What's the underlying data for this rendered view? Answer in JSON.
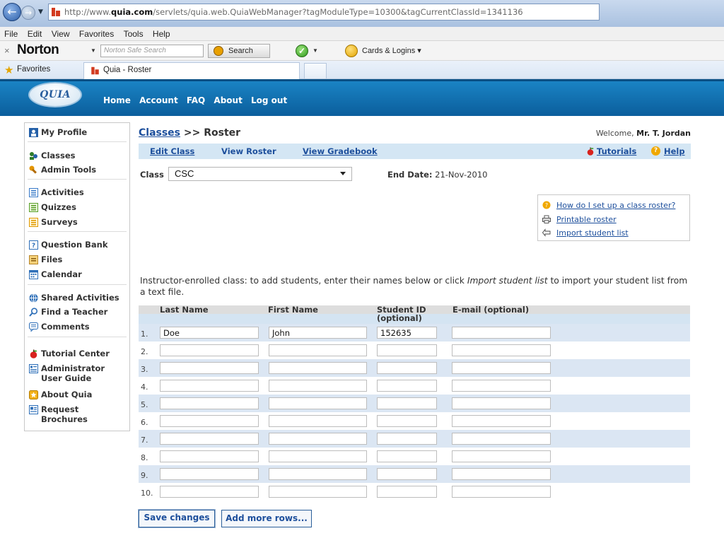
{
  "browser": {
    "url_prefix": "http://www.",
    "url_domain": "quia.com",
    "url_rest": "/servlets/quia.web.QuiaWebManager?tagModuleType=10300&tagCurrentClassId=1341136",
    "menu": [
      "File",
      "Edit",
      "View",
      "Favorites",
      "Tools",
      "Help"
    ],
    "norton_logo": "Norton",
    "norton_search_placeholder": "Norton Safe Search",
    "norton_search_button": "Search",
    "cards_logins": "Cards & Logins",
    "favorites_label": "Favorites",
    "tab_title": "Quia - Roster"
  },
  "header": {
    "logo_text": "QUIA",
    "nav": [
      "Home",
      "Account",
      "FAQ",
      "About",
      "Log out"
    ]
  },
  "sidebar": {
    "items": [
      {
        "label": "My Profile",
        "icon": "profile-icon"
      },
      {
        "label": "Classes",
        "icon": "classes-icon"
      },
      {
        "label": "Admin Tools",
        "icon": "admin-tools-icon"
      },
      {
        "label": "Activities",
        "icon": "activities-icon"
      },
      {
        "label": "Quizzes",
        "icon": "quizzes-icon"
      },
      {
        "label": "Surveys",
        "icon": "surveys-icon"
      },
      {
        "label": "Question Bank",
        "icon": "question-bank-icon"
      },
      {
        "label": "Files",
        "icon": "files-icon"
      },
      {
        "label": "Calendar",
        "icon": "calendar-icon"
      },
      {
        "label": "Shared Activities",
        "icon": "shared-activities-icon"
      },
      {
        "label": "Find a Teacher",
        "icon": "find-teacher-icon"
      },
      {
        "label": "Comments",
        "icon": "comments-icon"
      },
      {
        "label": "Tutorial Center",
        "icon": "apple-icon"
      },
      {
        "label": "Administrator",
        "label2": "User Guide",
        "icon": "guide-icon"
      },
      {
        "label": "About Quia",
        "icon": "about-icon"
      },
      {
        "label": "Request",
        "label2": "Brochures",
        "icon": "brochure-icon"
      }
    ]
  },
  "main": {
    "breadcrumb_link": "Classes",
    "breadcrumb_rest": ">> Roster",
    "welcome_prefix": "Welcome,",
    "welcome_name": "Mr. T. Jordan",
    "subnav": {
      "edit_class": "Edit Class",
      "view_roster": "View Roster",
      "view_gradebook": "View Gradebook",
      "tutorials": "Tutorials",
      "help": "Help"
    },
    "class_label": "Class",
    "class_value": "CSC",
    "end_date_label": "End Date:",
    "end_date_value": "21-Nov-2010",
    "help_links": [
      "How do I set up a class roster?",
      "Printable roster",
      "Import student list"
    ],
    "instructions_a": "Instructor-enrolled class: to add students, enter their names below or click ",
    "instructions_link": "Import student list",
    "instructions_b": " to import your student list from a text file.",
    "table": {
      "headers": {
        "last": "Last Name",
        "first": "First Name",
        "id_line1": "Student ID",
        "id_line2": "(optional)",
        "email": "E-mail (optional)"
      },
      "rows": [
        {
          "num": "1.",
          "last": "Doe",
          "first": "John",
          "id": "152635",
          "email": ""
        },
        {
          "num": "2.",
          "last": "",
          "first": "",
          "id": "",
          "email": ""
        },
        {
          "num": "3.",
          "last": "",
          "first": "",
          "id": "",
          "email": ""
        },
        {
          "num": "4.",
          "last": "",
          "first": "",
          "id": "",
          "email": ""
        },
        {
          "num": "5.",
          "last": "",
          "first": "",
          "id": "",
          "email": ""
        },
        {
          "num": "6.",
          "last": "",
          "first": "",
          "id": "",
          "email": ""
        },
        {
          "num": "7.",
          "last": "",
          "first": "",
          "id": "",
          "email": ""
        },
        {
          "num": "8.",
          "last": "",
          "first": "",
          "id": "",
          "email": ""
        },
        {
          "num": "9.",
          "last": "",
          "first": "",
          "id": "",
          "email": ""
        },
        {
          "num": "10.",
          "last": "",
          "first": "",
          "id": "",
          "email": ""
        }
      ]
    },
    "buttons": {
      "save": "Save changes",
      "add_rows": "Add more rows..."
    }
  }
}
